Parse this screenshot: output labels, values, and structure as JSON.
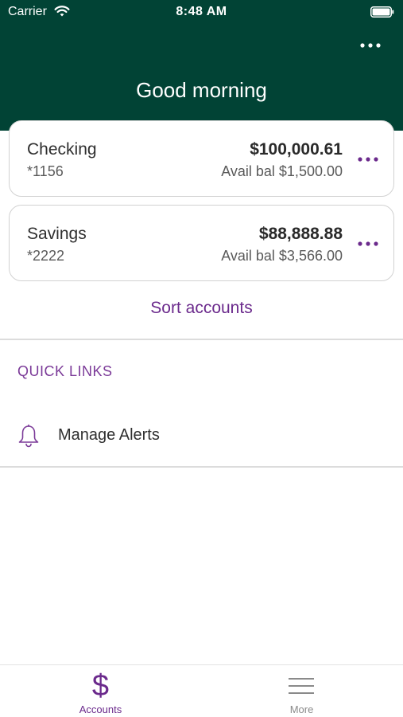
{
  "status_bar": {
    "carrier": "Carrier",
    "time": "8:48 AM"
  },
  "header": {
    "greeting": "Good morning"
  },
  "accounts": [
    {
      "name": "Checking",
      "number": "*1156",
      "balance": "$100,000.61",
      "available": "Avail bal $1,500.00"
    },
    {
      "name": "Savings",
      "number": "*2222",
      "balance": "$88,888.88",
      "available": "Avail bal $3,566.00"
    }
  ],
  "sort_label": "Sort accounts",
  "quick_links": {
    "title": "QUICK LINKS",
    "items": [
      {
        "label": "Manage Alerts",
        "icon": "bell-icon"
      }
    ]
  },
  "tabs": [
    {
      "label": "Accounts",
      "icon": "dollar-icon",
      "active": true
    },
    {
      "label": "More",
      "icon": "menu-icon",
      "active": false
    }
  ],
  "colors": {
    "header_bg": "#014335",
    "accent": "#6b2a8c"
  }
}
